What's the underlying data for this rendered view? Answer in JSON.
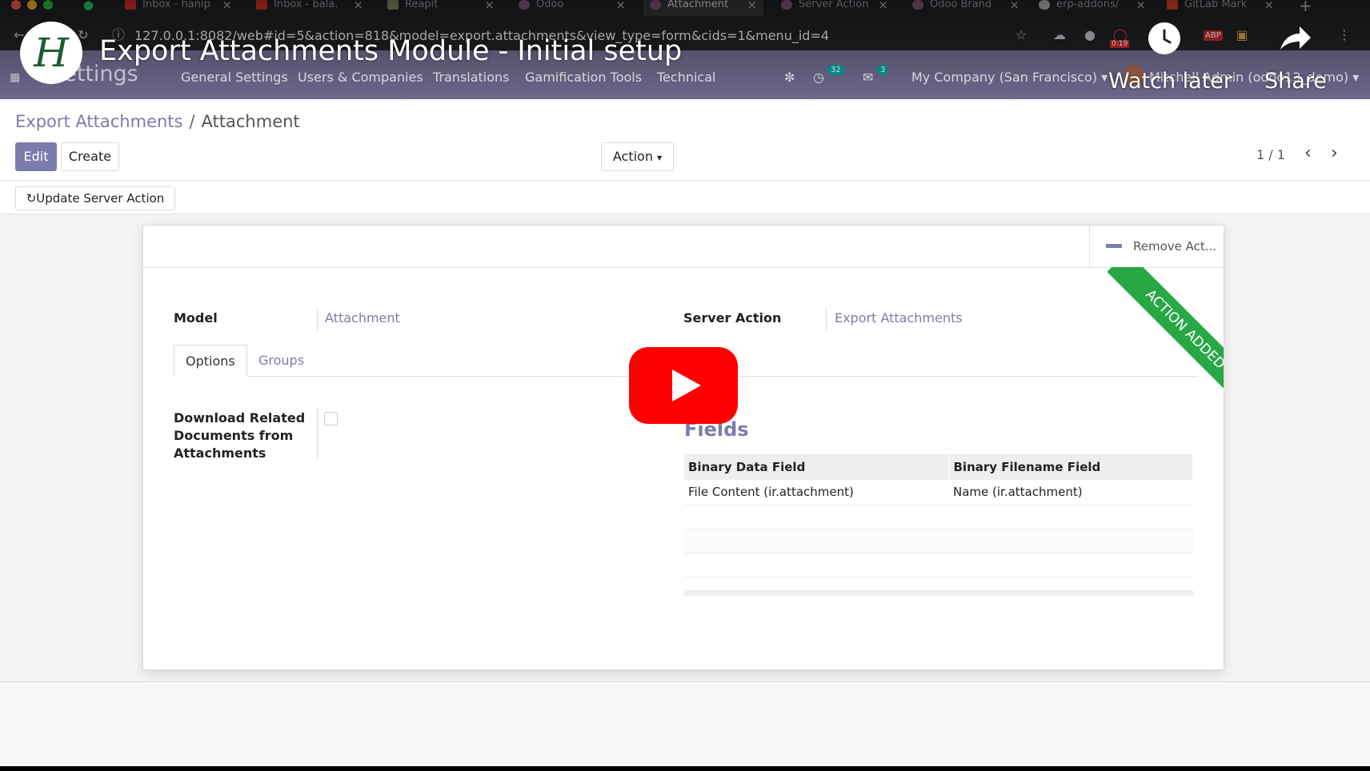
{
  "browser": {
    "tabs": [
      {
        "title": "Inbox - hanip",
        "favicon_color": "#d93025"
      },
      {
        "title": "Inbox - bala.",
        "favicon_color": "#d93025"
      },
      {
        "title": "Reapit",
        "favicon_color": "#8a8a6a"
      },
      {
        "title": "Odoo",
        "favicon_color": "#875a7b"
      },
      {
        "title": "Attachment",
        "favicon_color": "#875a7b"
      },
      {
        "title": "Server Action",
        "favicon_color": "#875a7b"
      },
      {
        "title": "Odoo Brand",
        "favicon_color": "#875a7b"
      },
      {
        "title": "erp-addons/",
        "favicon_color": "#bbbbbb"
      },
      {
        "title": "GitLab Mark",
        "favicon_color": "#e24329"
      }
    ],
    "url": "127.0.0.1:8082/web#id=5&action=818&model=export.attachments&view_type=form&cids=1&menu_id=4",
    "timer_badge": "0:19",
    "abp_label": "ABP"
  },
  "navbar": {
    "brand": "Settings",
    "menus": [
      "General Settings",
      "Users & Companies",
      "Translations",
      "Gamification Tools",
      "Technical"
    ],
    "activity_count": "32",
    "message_count": "3",
    "company": "My Company (San Francisco)",
    "user": "Mitchell Admin (odoo13_demo)"
  },
  "control_panel": {
    "breadcrumb_parent": "Export Attachments",
    "breadcrumb_separator": "/",
    "breadcrumb_current": "Attachment",
    "edit_label": "Edit",
    "create_label": "Create",
    "action_label": "Action",
    "pager": "1 / 1"
  },
  "statusbar": {
    "update_button": "Update Server Action"
  },
  "form": {
    "remove_action_label": "Remove Act...",
    "ribbon_text": "ACTION ADDED",
    "model_label": "Model",
    "model_value": "Attachment",
    "server_action_label": "Server Action",
    "server_action_value": "Export Attachments",
    "tabs": [
      "Options",
      "Groups"
    ],
    "download_related_label": "Download Related Documents from Attachments",
    "download_related_checked": false,
    "fields_title": "Fields",
    "fields_table": {
      "columns": [
        "Binary Data Field",
        "Binary Filename Field"
      ],
      "rows": [
        [
          "File Content (ir.attachment)",
          "Name (ir.attachment)"
        ]
      ]
    }
  },
  "youtube": {
    "video_title": "Export Attachments Module - Initial setup",
    "watch_later": "Watch later",
    "share": "Share",
    "play_color": "#ff0000"
  }
}
